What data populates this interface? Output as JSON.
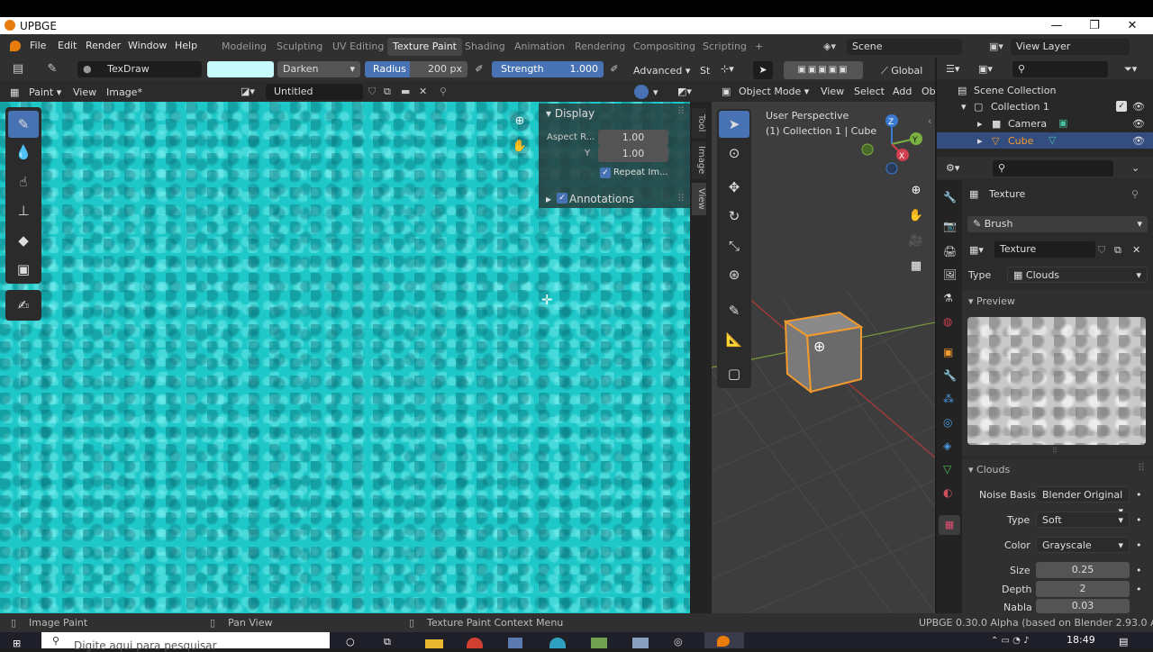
{
  "window": {
    "title": "UPBGE",
    "min": "—",
    "max": "❐",
    "close": "✕"
  },
  "menu": [
    "File",
    "Edit",
    "Render",
    "Window",
    "Help"
  ],
  "workspaces": [
    {
      "label": "Modeling",
      "active": false
    },
    {
      "label": "Sculpting",
      "active": false
    },
    {
      "label": "UV Editing",
      "active": false
    },
    {
      "label": "Texture Paint",
      "active": true
    },
    {
      "label": "Shading",
      "active": false
    },
    {
      "label": "Animation",
      "active": false
    },
    {
      "label": "Rendering",
      "active": false
    },
    {
      "label": "Compositing",
      "active": false
    },
    {
      "label": "Scripting",
      "active": false
    }
  ],
  "add_workspace": "+",
  "scene": {
    "label": "Scene",
    "view_layer": "View Layer"
  },
  "tool_header": {
    "brush_name": "TexDraw",
    "color_hex": "#c7fafa",
    "blend": "Darken",
    "radius_label": "Radius",
    "radius_value": "200 px",
    "strength_label": "Strength",
    "strength_value": "1.000",
    "advanced": "Advanced",
    "more": "St"
  },
  "image_header": {
    "mode": "Paint",
    "view": "View",
    "image_menu": "Image*",
    "image_name": "Untitled"
  },
  "npanel": {
    "display_title": "Display",
    "aspect_label": "Aspect R...",
    "aspect_x": "1.00",
    "y_label": "Y",
    "aspect_y": "1.00",
    "repeat_label": "Repeat Im...",
    "annotations_label": "Annotations",
    "tabs": [
      "Tool",
      "Image",
      "View"
    ]
  },
  "viewport_header": {
    "transform_space": "Global",
    "mode": "Object Mode",
    "view": "View",
    "select": "Select",
    "add": "Add",
    "object_more": "Ob"
  },
  "viewport": {
    "perspective": "User Perspective",
    "context": "(1) Collection 1 | Cube"
  },
  "outliner": {
    "scene_collection": "Scene Collection",
    "items": [
      {
        "label": "Collection 1"
      },
      {
        "label": "Camera"
      },
      {
        "label": "Cube"
      }
    ]
  },
  "properties": {
    "context": "Texture",
    "brush_label": "Brush",
    "texture_name": "Texture",
    "type_label": "Type",
    "type_value": "Clouds",
    "preview_label": "Preview",
    "clouds_label": "Clouds",
    "fields": [
      {
        "label": "Noise Basis",
        "value": "Blender Original"
      },
      {
        "label": "Type",
        "value": "Soft"
      },
      {
        "label": "Color",
        "value": "Grayscale"
      }
    ],
    "numbers": [
      {
        "label": "Size",
        "value": "0.25"
      },
      {
        "label": "Depth",
        "value": "2"
      },
      {
        "label": "Nabla",
        "value": "0.03"
      }
    ]
  },
  "status": {
    "left": "Image Paint",
    "mid": "Pan View",
    "right_ctx": "Texture Paint Context Menu",
    "version": "UPBGE 0.30.0 Alpha (based on Blender 2.93.0 Alpha)"
  },
  "taskbar": {
    "search_placeholder": "Digite aqui para pesquisar",
    "time": "18:49"
  }
}
